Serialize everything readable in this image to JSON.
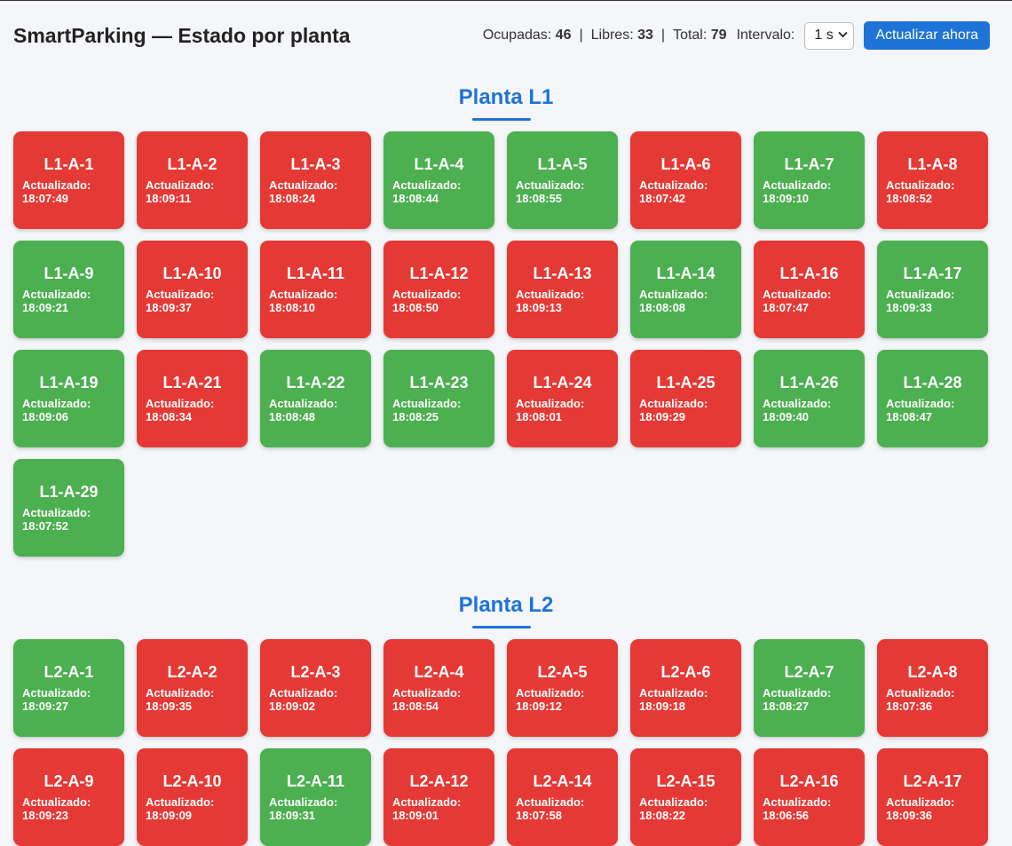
{
  "header": {
    "title": "SmartParking — Estado por planta",
    "ocupadas_label": "Ocupadas:",
    "ocupadas": "46",
    "libres_label": "Libres:",
    "libres": "33",
    "total_label": "Total:",
    "total": "79",
    "separator": "|",
    "interval_label": "Intervalo:",
    "interval_value": "1 s",
    "refresh_button": "Actualizar ahora"
  },
  "updated_label": "Actualizado:",
  "colors": {
    "occupied": "#e53935",
    "free": "#4caf50",
    "accent": "#1f73d6"
  },
  "floors": [
    {
      "title": "Planta L1",
      "spots": [
        {
          "id": "L1-A-1",
          "status": "occupied",
          "time": "18:07:49"
        },
        {
          "id": "L1-A-2",
          "status": "occupied",
          "time": "18:09:11"
        },
        {
          "id": "L1-A-3",
          "status": "occupied",
          "time": "18:08:24"
        },
        {
          "id": "L1-A-4",
          "status": "free",
          "time": "18:08:44"
        },
        {
          "id": "L1-A-5",
          "status": "free",
          "time": "18:08:55"
        },
        {
          "id": "L1-A-6",
          "status": "occupied",
          "time": "18:07:42"
        },
        {
          "id": "L1-A-7",
          "status": "free",
          "time": "18:09:10"
        },
        {
          "id": "L1-A-8",
          "status": "occupied",
          "time": "18:08:52"
        },
        {
          "id": "L1-A-9",
          "status": "free",
          "time": "18:09:21"
        },
        {
          "id": "L1-A-10",
          "status": "occupied",
          "time": "18:09:37"
        },
        {
          "id": "L1-A-11",
          "status": "occupied",
          "time": "18:08:10"
        },
        {
          "id": "L1-A-12",
          "status": "occupied",
          "time": "18:08:50"
        },
        {
          "id": "L1-A-13",
          "status": "occupied",
          "time": "18:09:13"
        },
        {
          "id": "L1-A-14",
          "status": "free",
          "time": "18:08:08"
        },
        {
          "id": "L1-A-16",
          "status": "occupied",
          "time": "18:07:47"
        },
        {
          "id": "L1-A-17",
          "status": "free",
          "time": "18:09:33"
        },
        {
          "id": "L1-A-19",
          "status": "free",
          "time": "18:09:06"
        },
        {
          "id": "L1-A-21",
          "status": "occupied",
          "time": "18:08:34"
        },
        {
          "id": "L1-A-22",
          "status": "free",
          "time": "18:08:48"
        },
        {
          "id": "L1-A-23",
          "status": "free",
          "time": "18:08:25"
        },
        {
          "id": "L1-A-24",
          "status": "occupied",
          "time": "18:08:01"
        },
        {
          "id": "L1-A-25",
          "status": "occupied",
          "time": "18:09:29"
        },
        {
          "id": "L1-A-26",
          "status": "free",
          "time": "18:09:40"
        },
        {
          "id": "L1-A-28",
          "status": "free",
          "time": "18:08:47"
        },
        {
          "id": "L1-A-29",
          "status": "free",
          "time": "18:07:52"
        }
      ]
    },
    {
      "title": "Planta L2",
      "spots": [
        {
          "id": "L2-A-1",
          "status": "free",
          "time": "18:09:27"
        },
        {
          "id": "L2-A-2",
          "status": "occupied",
          "time": "18:09:35"
        },
        {
          "id": "L2-A-3",
          "status": "occupied",
          "time": "18:09:02"
        },
        {
          "id": "L2-A-4",
          "status": "occupied",
          "time": "18:08:54"
        },
        {
          "id": "L2-A-5",
          "status": "occupied",
          "time": "18:09:12"
        },
        {
          "id": "L2-A-6",
          "status": "occupied",
          "time": "18:09:18"
        },
        {
          "id": "L2-A-7",
          "status": "free",
          "time": "18:08:27"
        },
        {
          "id": "L2-A-8",
          "status": "occupied",
          "time": "18:07:36"
        },
        {
          "id": "L2-A-9",
          "status": "occupied",
          "time": "18:09:23"
        },
        {
          "id": "L2-A-10",
          "status": "occupied",
          "time": "18:09:09"
        },
        {
          "id": "L2-A-11",
          "status": "free",
          "time": "18:09:31"
        },
        {
          "id": "L2-A-12",
          "status": "occupied",
          "time": "18:09:01"
        },
        {
          "id": "L2-A-14",
          "status": "occupied",
          "time": "18:07:58"
        },
        {
          "id": "L2-A-15",
          "status": "occupied",
          "time": "18:08:22"
        },
        {
          "id": "L2-A-16",
          "status": "occupied",
          "time": "18:06:56"
        },
        {
          "id": "L2-A-17",
          "status": "occupied",
          "time": "18:09:36"
        }
      ]
    }
  ]
}
